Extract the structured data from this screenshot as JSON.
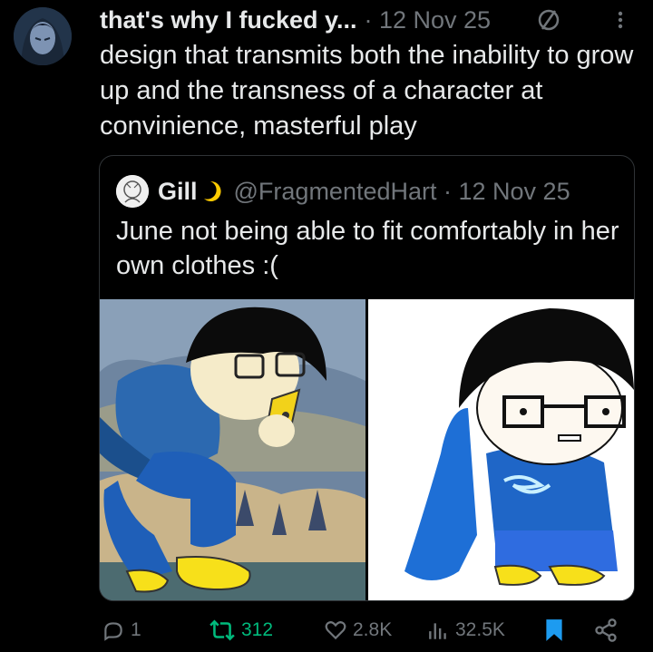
{
  "post": {
    "display_name": "that's why I fucked y...",
    "meta": "· 12 Nov 25",
    "text": "design that transmits both the inability to grow up and the transness of a character at convinience, masterful play"
  },
  "quote": {
    "display_name": "Gill",
    "meta": "@FragmentedHart · 12 Nov 25",
    "text": "June not being able to fit comfortably in her own clothes :("
  },
  "actions": {
    "replies": "1",
    "reposts": "312",
    "likes": "2.8K",
    "views": "32.5K"
  },
  "colors": {
    "muted": "#71767b",
    "repost_active": "#00ba7c",
    "bookmark_active": "#1d9bf0",
    "border": "#2f3336"
  },
  "icons": [
    "avatar",
    "verify-icon",
    "more-icon",
    "moon-icon",
    "reply-icon",
    "repost-icon",
    "like-icon",
    "views-icon",
    "bookmark-icon",
    "share-icon"
  ]
}
